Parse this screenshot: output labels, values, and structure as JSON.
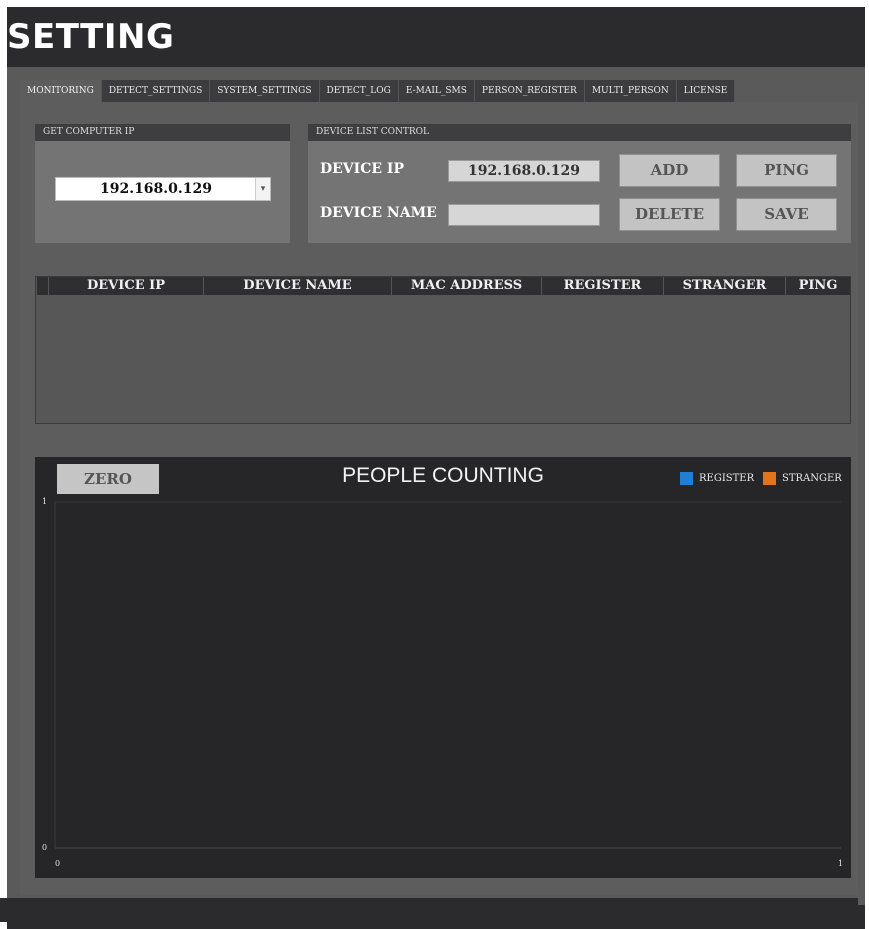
{
  "title": "SETTING",
  "tabs": [
    "MONITORING",
    "DETECT_SETTINGS",
    "SYSTEM_SETTINGS",
    "DETECT_LOG",
    "E-MAIL_SMS",
    "PERSON_REGISTER",
    "MULTI_PERSON",
    "LICENSE"
  ],
  "get_ip": {
    "header": "GET COMPUTER IP",
    "value": "192.168.0.129",
    "arrow": "▾"
  },
  "device_control": {
    "header": "DEVICE LIST CONTROL",
    "ip_label": "DEVICE IP",
    "ip_value": "192.168.0.129",
    "name_label": "DEVICE NAME",
    "name_value": "",
    "add": "ADD",
    "ping": "PING",
    "delete": "DELETE",
    "save": "SAVE"
  },
  "table": {
    "columns": [
      "DEVICE IP",
      "DEVICE NAME",
      "MAC ADDRESS",
      "REGISTER",
      "STRANGER",
      "PING"
    ]
  },
  "chart": {
    "zero_button": "ZERO",
    "title": "PEOPLE COUNTING",
    "legend_register": "REGISTER",
    "legend_stranger": "STRANGER",
    "register_color": "#1e7fd4",
    "stranger_color": "#e2741b",
    "y_max_tick": "1",
    "y_min_tick": "0",
    "x_min_tick": "0",
    "x_max_tick": "1"
  },
  "chart_data": {
    "type": "line",
    "title": "PEOPLE COUNTING",
    "xlim": [
      0,
      1
    ],
    "ylim": [
      0,
      1
    ],
    "series": [
      {
        "name": "REGISTER",
        "values": []
      },
      {
        "name": "STRANGER",
        "values": []
      }
    ],
    "legend": "top-right",
    "grid": false
  }
}
